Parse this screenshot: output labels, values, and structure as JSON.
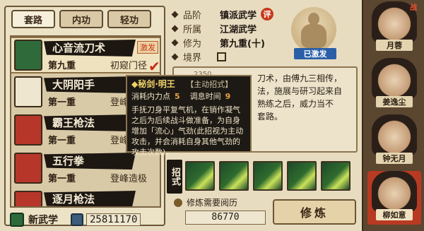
{
  "tabs": [
    "套路",
    "内功",
    "轻功"
  ],
  "skills": [
    {
      "name": "心音流刀术",
      "level": "第九重",
      "realm": "初窥门径",
      "badge": "激发",
      "checked": true,
      "color": "#2f6a3a"
    },
    {
      "name": "大阴阳手",
      "level": "第一重",
      "realm": "登峰造",
      "color": "#efe6cf"
    },
    {
      "name": "霸王枪法",
      "level": "第一重",
      "realm": "登峰造",
      "color": "#b7362a"
    },
    {
      "name": "五行拳",
      "level": "第一重",
      "realm": "登峰造极",
      "color": "#b7362a"
    },
    {
      "name": "逐月枪法",
      "level": "",
      "realm": "",
      "color": "#b7362a"
    }
  ],
  "bottom_left": {
    "new_label": "新武学",
    "coins": "25811170"
  },
  "info": {
    "rows": [
      {
        "key": "品阶",
        "value": "镇派武学",
        "tag": "评"
      },
      {
        "key": "所属",
        "value": "江湖武学"
      },
      {
        "key": "修为",
        "value": "第九重(十)"
      },
      {
        "key": "境界",
        "value": ""
      }
    ],
    "activated_label": "已激发"
  },
  "description": {
    "partial_num": "2350",
    "lines": [
      "刀术，由傅九三相传，",
      "法，施展与研习起来自",
      "熟练之后，威力当不",
      "套路。"
    ]
  },
  "tooltip": {
    "title": "◆秘剑·明王",
    "tag": "【主动招式】",
    "cost_label": "消耗内力点",
    "cost_value": "5",
    "breath_label": "调息时间",
    "breath_value": "9",
    "body": "手抚刀身平复气机，在销作凝气之后为后续战斗做准备，为自身增加「流心」气劲(此招视为主动攻击，并会消耗自身其他气劲的攻击次数)。"
  },
  "moves": {
    "label": "招式",
    "count": 5
  },
  "exp": {
    "label": "修炼需要阅历",
    "value": "86770"
  },
  "train_button": "修炼",
  "heroes": [
    {
      "name": "月蓉",
      "badge": "战"
    },
    {
      "name": "姜逸尘"
    },
    {
      "name": "钟无月"
    },
    {
      "name": "柳如意",
      "selected": true
    }
  ]
}
